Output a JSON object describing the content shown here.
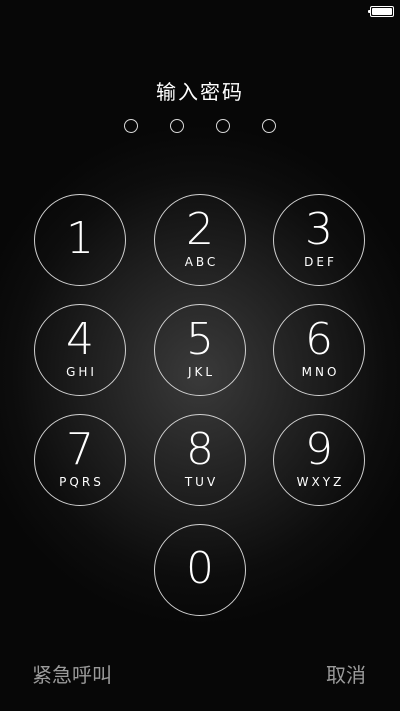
{
  "status_bar": {
    "battery_level": 1.0,
    "battery_icon": "battery-icon"
  },
  "passcode": {
    "prompt": "输入密码",
    "length": 4,
    "entered": 0
  },
  "keypad": {
    "keys": [
      {
        "digit": "1",
        "letters": ""
      },
      {
        "digit": "2",
        "letters": "ABC"
      },
      {
        "digit": "3",
        "letters": "DEF"
      },
      {
        "digit": "4",
        "letters": "GHI"
      },
      {
        "digit": "5",
        "letters": "JKL"
      },
      {
        "digit": "6",
        "letters": "MNO"
      },
      {
        "digit": "7",
        "letters": "PQRS"
      },
      {
        "digit": "8",
        "letters": "TUV"
      },
      {
        "digit": "9",
        "letters": "WXYZ"
      },
      {
        "digit": "0",
        "letters": ""
      }
    ]
  },
  "footer": {
    "emergency_label": "紧急呼叫",
    "cancel_label": "取消"
  }
}
